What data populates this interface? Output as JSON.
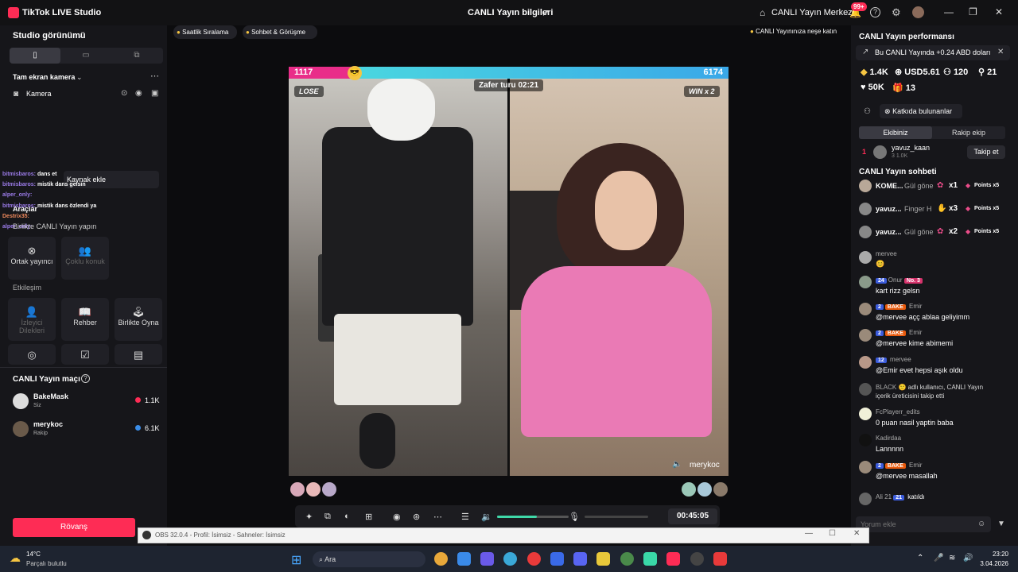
{
  "titlebar": {
    "app_title": "TikTok LIVE Studio",
    "center_title": "CANLI Yayın bilgileri",
    "center_link": "CANLI Yayın Merkezi",
    "notif_count": "99+"
  },
  "top_pills": {
    "hourly_ranking": "Saatlik Sıralama",
    "chat_meet": "Sohbet & Görüşme",
    "tip": "CANLI Yayınınıza neşe katın"
  },
  "left": {
    "studio_view": "Studio görünümü",
    "fullscreen_camera": "Tam ekran kamera",
    "camera": "Kamera",
    "add_source": "Kaynak ekle",
    "tools": "Araçlar",
    "go_live_together": "Birlikte CANLI Yayın yapın",
    "co_host": "Ortak yayıncı",
    "multi_guest": "Çoklu konuk",
    "interaction": "Etkileşim",
    "viewer_wishes": "İzleyici Dilekleri",
    "guide": "Rehber",
    "play_together": "Birlikte Oyna",
    "live_match": "CANLI Yayın maçı",
    "players": [
      {
        "name": "BakeMask",
        "sub": "Siz",
        "score": "1.1K"
      },
      {
        "name": "merykoc",
        "sub": "Rakip",
        "score": "6.1K"
      }
    ],
    "rematch": "Rövanş"
  },
  "chat_overlay": [
    {
      "user": "bitmisbaros:",
      "text": "dans et"
    },
    {
      "user": "bitmisbaros:",
      "text": "mistik dans gelsin"
    },
    {
      "user": "alper_only:",
      "text": ""
    },
    {
      "user": "bitmisbaros:",
      "text": "mistik dans özlendi ya"
    },
    {
      "user": "Destrix35:",
      "text": ""
    },
    {
      "user": "alper_only:",
      "text": ""
    }
  ],
  "battle": {
    "left_score": "1117",
    "right_score": "6174",
    "left_fraction": 0.153,
    "round_label": "Zafer turu 02:21",
    "left_status": "LOSE",
    "right_status": "WIN x 2",
    "opponent": "merykoc",
    "timer": "00:45:05"
  },
  "right": {
    "performance": "CANLI Yayın performansı",
    "banner": "Bu CANLI Yayında +0.24 ABD doları",
    "stats": [
      "1.4K",
      "USD5.61",
      "120",
      "21",
      "50K",
      "13"
    ],
    "contributors": "Katkıda bulunanlar",
    "tab_ours": "Ekibiniz",
    "tab_rival": "Rakip ekip",
    "rank_no": "1",
    "rank_user": "yavuz_kaan",
    "rank_sub": "3  1.0K",
    "follow": "Takip et",
    "chat_title": "CANLI Yayın sohbeti",
    "gifts": [
      {
        "user": "KOME...",
        "act": "Gül göne",
        "mult": "x1",
        "pts": "Points x5"
      },
      {
        "user": "yavuz...",
        "act": "Finger H",
        "mult": "x3",
        "pts": "Points x5"
      },
      {
        "user": "yavuz...",
        "act": "Gül göne",
        "mult": "x2",
        "pts": "Points x5"
      }
    ],
    "messages": [
      {
        "user": "mervee",
        "b1": "",
        "b2": "",
        "text": ""
      },
      {
        "user": "Onur",
        "b1": "24",
        "b2": "No. 3",
        "text": "kart rizz gelsn"
      },
      {
        "user": "Emir",
        "b1": "2",
        "b2": "BAKE",
        "text": "@mervee açç ablaa geliyimm"
      },
      {
        "user": "Emir",
        "b1": "2",
        "b2": "BAKE",
        "text": "@mervee kime abimemi"
      },
      {
        "user": "mervee",
        "b1": "12",
        "b2": "",
        "text": "@Emir evet hepsi aşık oldu"
      },
      {
        "user": "BLACK",
        "b1": "",
        "b2": "",
        "text": "adlı kullanıcı, CANLI Yayın"
      },
      {
        "user": "",
        "b1": "",
        "b2": "",
        "text": "içerik üreticisini takip etti"
      },
      {
        "user": "FcPlayerr_edits",
        "b1": "",
        "b2": "",
        "text": "0 puan nasil yaptin baba"
      },
      {
        "user": "Kadirdaa",
        "b1": "",
        "b2": "",
        "text": "Lannnnn"
      },
      {
        "user": "Emir",
        "b1": "2",
        "b2": "BAKE",
        "text": "@mervee masallah"
      }
    ],
    "joined_user": "Ali 21",
    "joined_badge": "21",
    "joined_text": "katıldı",
    "comment_placeholder": "Yorum ekle"
  },
  "obs": {
    "title": "OBS 32.0.4 - Profil: İsimsiz - Sahneler: İsimsiz"
  },
  "taskbar": {
    "temp": "14°C",
    "weather": "Parçalı bulutlu",
    "search": "Ara",
    "time": "23:20",
    "date": "3.04.2026"
  }
}
